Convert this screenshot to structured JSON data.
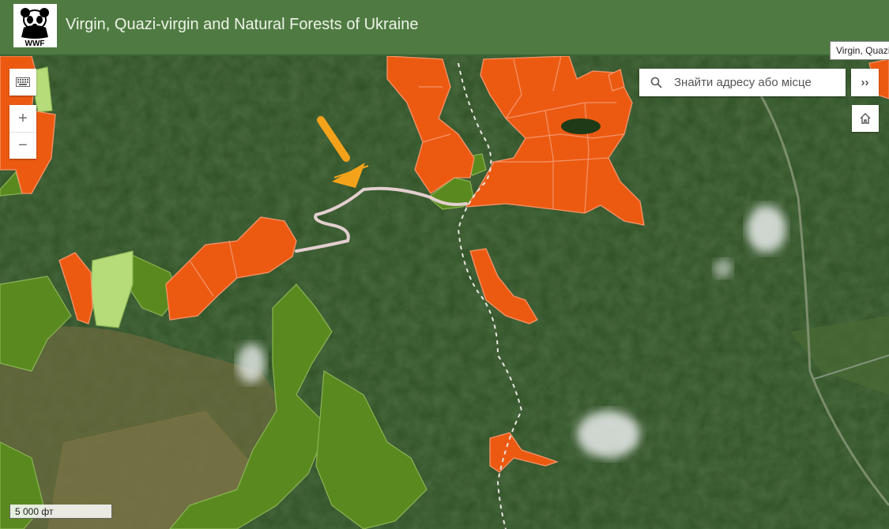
{
  "header": {
    "title": "Virgin, Quazi-virgin and Natural Forests of Ukraine",
    "logo_text": "WWF"
  },
  "tooltip": {
    "text": "Virgin, Quazi"
  },
  "search": {
    "placeholder": "Знайти адресу або місце",
    "icon": "search-icon"
  },
  "controls": {
    "zoom_in_label": "+",
    "zoom_out_label": "−",
    "expand_label": "››",
    "keyboard_icon": "keyboard-icon",
    "home_icon": "home-icon"
  },
  "scale_bar": {
    "label": "5 000 фт"
  },
  "colors": {
    "header": "#4f7b42",
    "virgin_forest": "#ec5a12",
    "natural_forest": "#5a8a1f",
    "light_forest": "#b5dc78",
    "arrow": "#f5a21b"
  }
}
